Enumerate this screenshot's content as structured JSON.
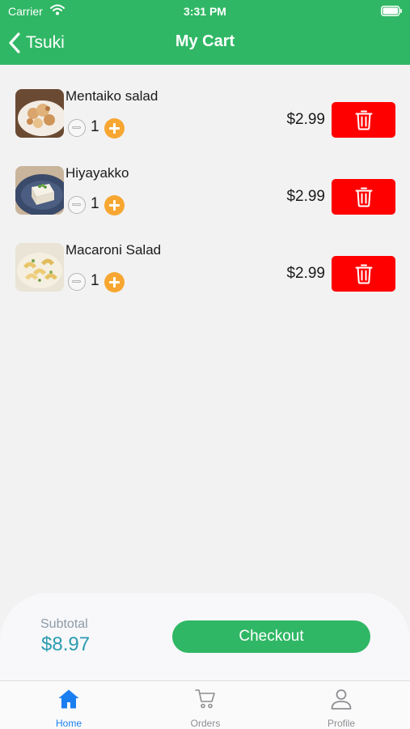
{
  "status_bar": {
    "carrier": "Carrier",
    "time": "3:31 PM"
  },
  "nav": {
    "back_label": "Tsuki",
    "title": "My Cart"
  },
  "cart": {
    "items": [
      {
        "name": "Mentaiko salad",
        "quantity": "1",
        "price": "$2.99"
      },
      {
        "name": "Hiyayakko",
        "quantity": "1",
        "price": "$2.99"
      },
      {
        "name": "Macaroni Salad",
        "quantity": "1",
        "price": "$2.99"
      }
    ]
  },
  "summary": {
    "subtotal_label": "Subtotal",
    "subtotal_value": "$8.97",
    "checkout_label": "Checkout"
  },
  "tabs": [
    {
      "label": "Home",
      "icon": "home-icon",
      "active": true
    },
    {
      "label": "Orders",
      "icon": "cart-icon",
      "active": false
    },
    {
      "label": "Profile",
      "icon": "user-icon",
      "active": false
    }
  ],
  "colors": {
    "primary_green": "#30b765",
    "delete_red": "#ff0000",
    "plus_orange": "#f7a731",
    "subtotal_teal": "#2a9bb0",
    "tab_active": "#1a7ef0",
    "tab_inactive": "#8e8e93"
  }
}
